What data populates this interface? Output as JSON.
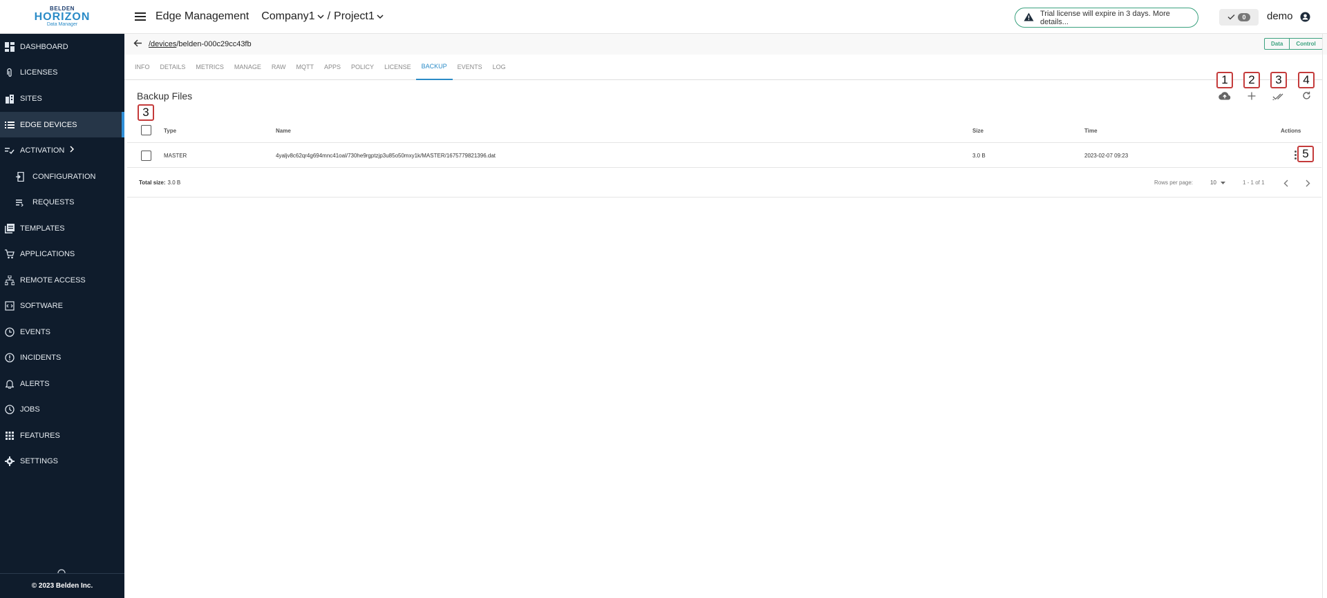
{
  "logo": {
    "top": "BELDEN",
    "main": "HORIZON",
    "sub": "Data Manager"
  },
  "sidebar": {
    "items": [
      {
        "label": "DASHBOARD",
        "icon": "dashboard-icon"
      },
      {
        "label": "LICENSES",
        "icon": "paperclip-icon"
      },
      {
        "label": "SITES",
        "icon": "building-icon"
      },
      {
        "label": "EDGE DEVICES",
        "icon": "list-icon",
        "active": true
      },
      {
        "label": "ACTIVATION",
        "icon": "activation-icon"
      },
      {
        "label": "CONFIGURATION",
        "icon": "configuration-icon"
      },
      {
        "label": "REQUESTS",
        "icon": "requests-icon"
      },
      {
        "label": "TEMPLATES",
        "icon": "templates-icon"
      },
      {
        "label": "APPLICATIONS",
        "icon": "cart-icon"
      },
      {
        "label": "REMOTE ACCESS",
        "icon": "network-icon"
      },
      {
        "label": "SOFTWARE",
        "icon": "software-icon"
      },
      {
        "label": "EVENTS",
        "icon": "events-icon"
      },
      {
        "label": "INCIDENTS",
        "icon": "incident-icon"
      },
      {
        "label": "ALERTS",
        "icon": "bell-icon"
      },
      {
        "label": "JOBS",
        "icon": "clock-icon"
      },
      {
        "label": "FEATURES",
        "icon": "grid-icon"
      },
      {
        "label": "SETTINGS",
        "icon": "gear-icon"
      }
    ],
    "footer": "© 2023 Belden Inc."
  },
  "header": {
    "title": "Edge Management",
    "company": "Company1",
    "separator": "/",
    "project": "Project1",
    "trial_text": "Trial license will expire in 3 days. More details...",
    "check_count": "0",
    "user": "demo"
  },
  "subheader": {
    "path_link": "/devices",
    "path_rest": "/belden-000c29cc43fb",
    "toggle_data": "Data",
    "toggle_control": "Control"
  },
  "tabs": [
    "INFO",
    "DETAILS",
    "METRICS",
    "MANAGE",
    "RAW",
    "MQTT",
    "APPS",
    "POLICY",
    "LICENSE",
    "BACKUP",
    "EVENTS",
    "LOG"
  ],
  "active_tab": "BACKUP",
  "section": {
    "title": "Backup Files"
  },
  "markers": [
    "1",
    "2",
    "3",
    "4",
    "3",
    "5"
  ],
  "table": {
    "columns": {
      "type": "Type",
      "name": "Name",
      "size": "Size",
      "time": "Time",
      "actions": "Actions"
    },
    "rows": [
      {
        "type": "MASTER",
        "name": "4yaljv8c62qr4g694mnc41oal/730he9rgptzjp3u85o50mxy1k/MASTER/1675779821396.dat",
        "size": "3.0 B",
        "time": "2023-02-07 09:23"
      }
    ],
    "total_label": "Total size:",
    "total_value": "3.0 B",
    "rows_per_page_label": "Rows per page:",
    "rows_per_page": "10",
    "range": "1 - 1 of 1"
  },
  "colors": {
    "sidebar_bg": "#0f1c2c",
    "accent": "#2a8bc7",
    "green": "#3aa17e",
    "marker_red": "#c43a3a"
  }
}
